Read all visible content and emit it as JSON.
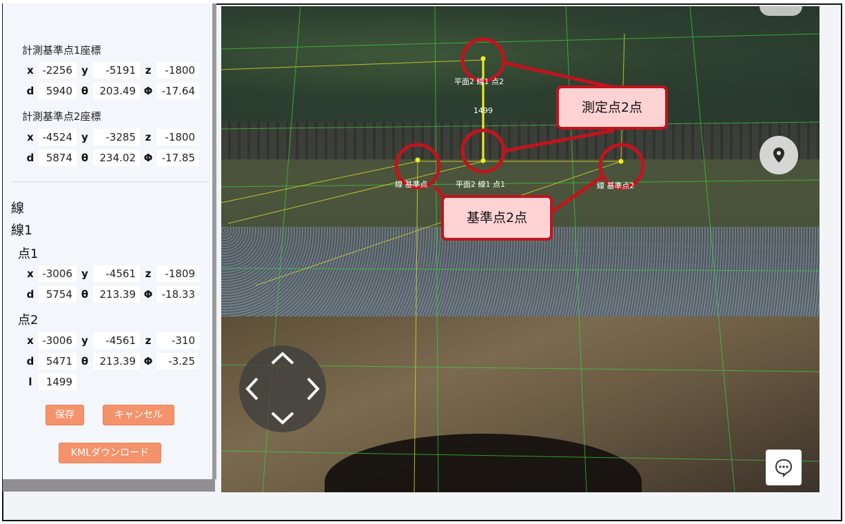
{
  "panel": {
    "ref1_title": "計測基準点1座標",
    "ref1": {
      "x": "-2256",
      "y": "-5191",
      "z": "-1800",
      "d": "5940",
      "theta": "203.49",
      "phi": "-17.64"
    },
    "ref2_title": "計測基準点2座標",
    "ref2": {
      "x": "-4524",
      "y": "-3285",
      "z": "-1800",
      "d": "5874",
      "theta": "234.02",
      "phi": "-17.85"
    },
    "line_heading": "線",
    "line_name": "線1",
    "p1_title": "点1",
    "p1": {
      "x": "-3006",
      "y": "-4561",
      "z": "-1809",
      "d": "5754",
      "theta": "213.39",
      "phi": "-18.33"
    },
    "p2_title": "点2",
    "p2": {
      "x": "-3006",
      "y": "-4561",
      "z": "-310",
      "d": "5471",
      "theta": "213.39",
      "phi": "-3.25"
    },
    "length": "1499",
    "labels": {
      "x": "x",
      "y": "y",
      "z": "z",
      "d": "d",
      "theta": "θ",
      "phi": "Φ",
      "l": "l"
    },
    "save_label": "保存",
    "cancel_label": "キャンセル",
    "kml_label": "KMLダウンロード"
  },
  "viewer": {
    "label_top": "平面2 線1 点2",
    "label_dist": "1499",
    "label_bottom": "平面2 線1 点1",
    "label_ref_left": "線 基準点",
    "label_ref_right": "線 基準点2",
    "callout_measure": "測定点2点",
    "callout_ref": "基準点2点",
    "accent": "#c0141e",
    "icons": [
      "location-pin-icon",
      "chat-icon",
      "nav-up-icon",
      "nav-down-icon",
      "nav-left-icon",
      "nav-right-icon"
    ]
  }
}
